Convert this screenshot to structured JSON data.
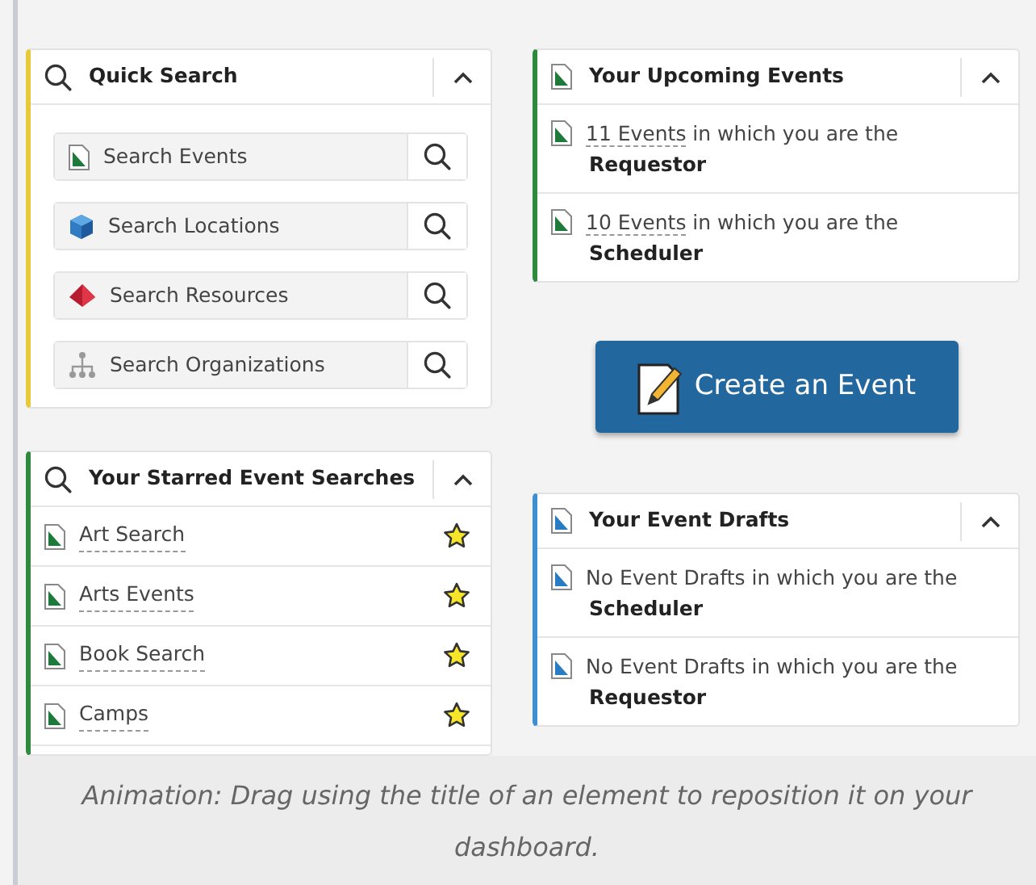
{
  "left_panels": [
    {
      "kind": "quick_search",
      "title": "Quick Search",
      "color": "#e8c93a",
      "items": [
        {
          "kind": "events",
          "label": "Search Events"
        },
        {
          "kind": "locations",
          "label": "Search Locations"
        },
        {
          "kind": "resources",
          "label": "Search Resources"
        },
        {
          "kind": "organizations",
          "label": "Search Organizations"
        }
      ]
    },
    {
      "kind": "starred",
      "title": "Your Starred Event Searches",
      "color": "#2e8b3e",
      "items": [
        {
          "label": "Art Search",
          "starred": true
        },
        {
          "label": "Arts Events",
          "starred": true
        },
        {
          "label": "Book Search",
          "starred": true
        },
        {
          "label": "Camps",
          "starred": true
        }
      ]
    }
  ],
  "right_panels": [
    {
      "kind": "upcoming",
      "title": "Your Upcoming Events",
      "color": "#2e8b3e",
      "items": [
        {
          "link": "11 Events",
          "text": "in which you are the",
          "role": "Requestor"
        },
        {
          "link": "10 Events",
          "text": "in which you are the",
          "role": "Scheduler"
        }
      ]
    },
    {
      "kind": "create_button",
      "label": "Create an Event"
    },
    {
      "kind": "drafts",
      "title": "Your Event Drafts",
      "color": "#3d8fd1",
      "items": [
        {
          "text": "No Event Drafts in which you are the",
          "role": "Scheduler"
        },
        {
          "text": "No Event Drafts in which you are the",
          "role": "Requestor"
        }
      ]
    }
  ],
  "caption": "Animation: Drag using the title of an element to reposition it on your dashboard."
}
